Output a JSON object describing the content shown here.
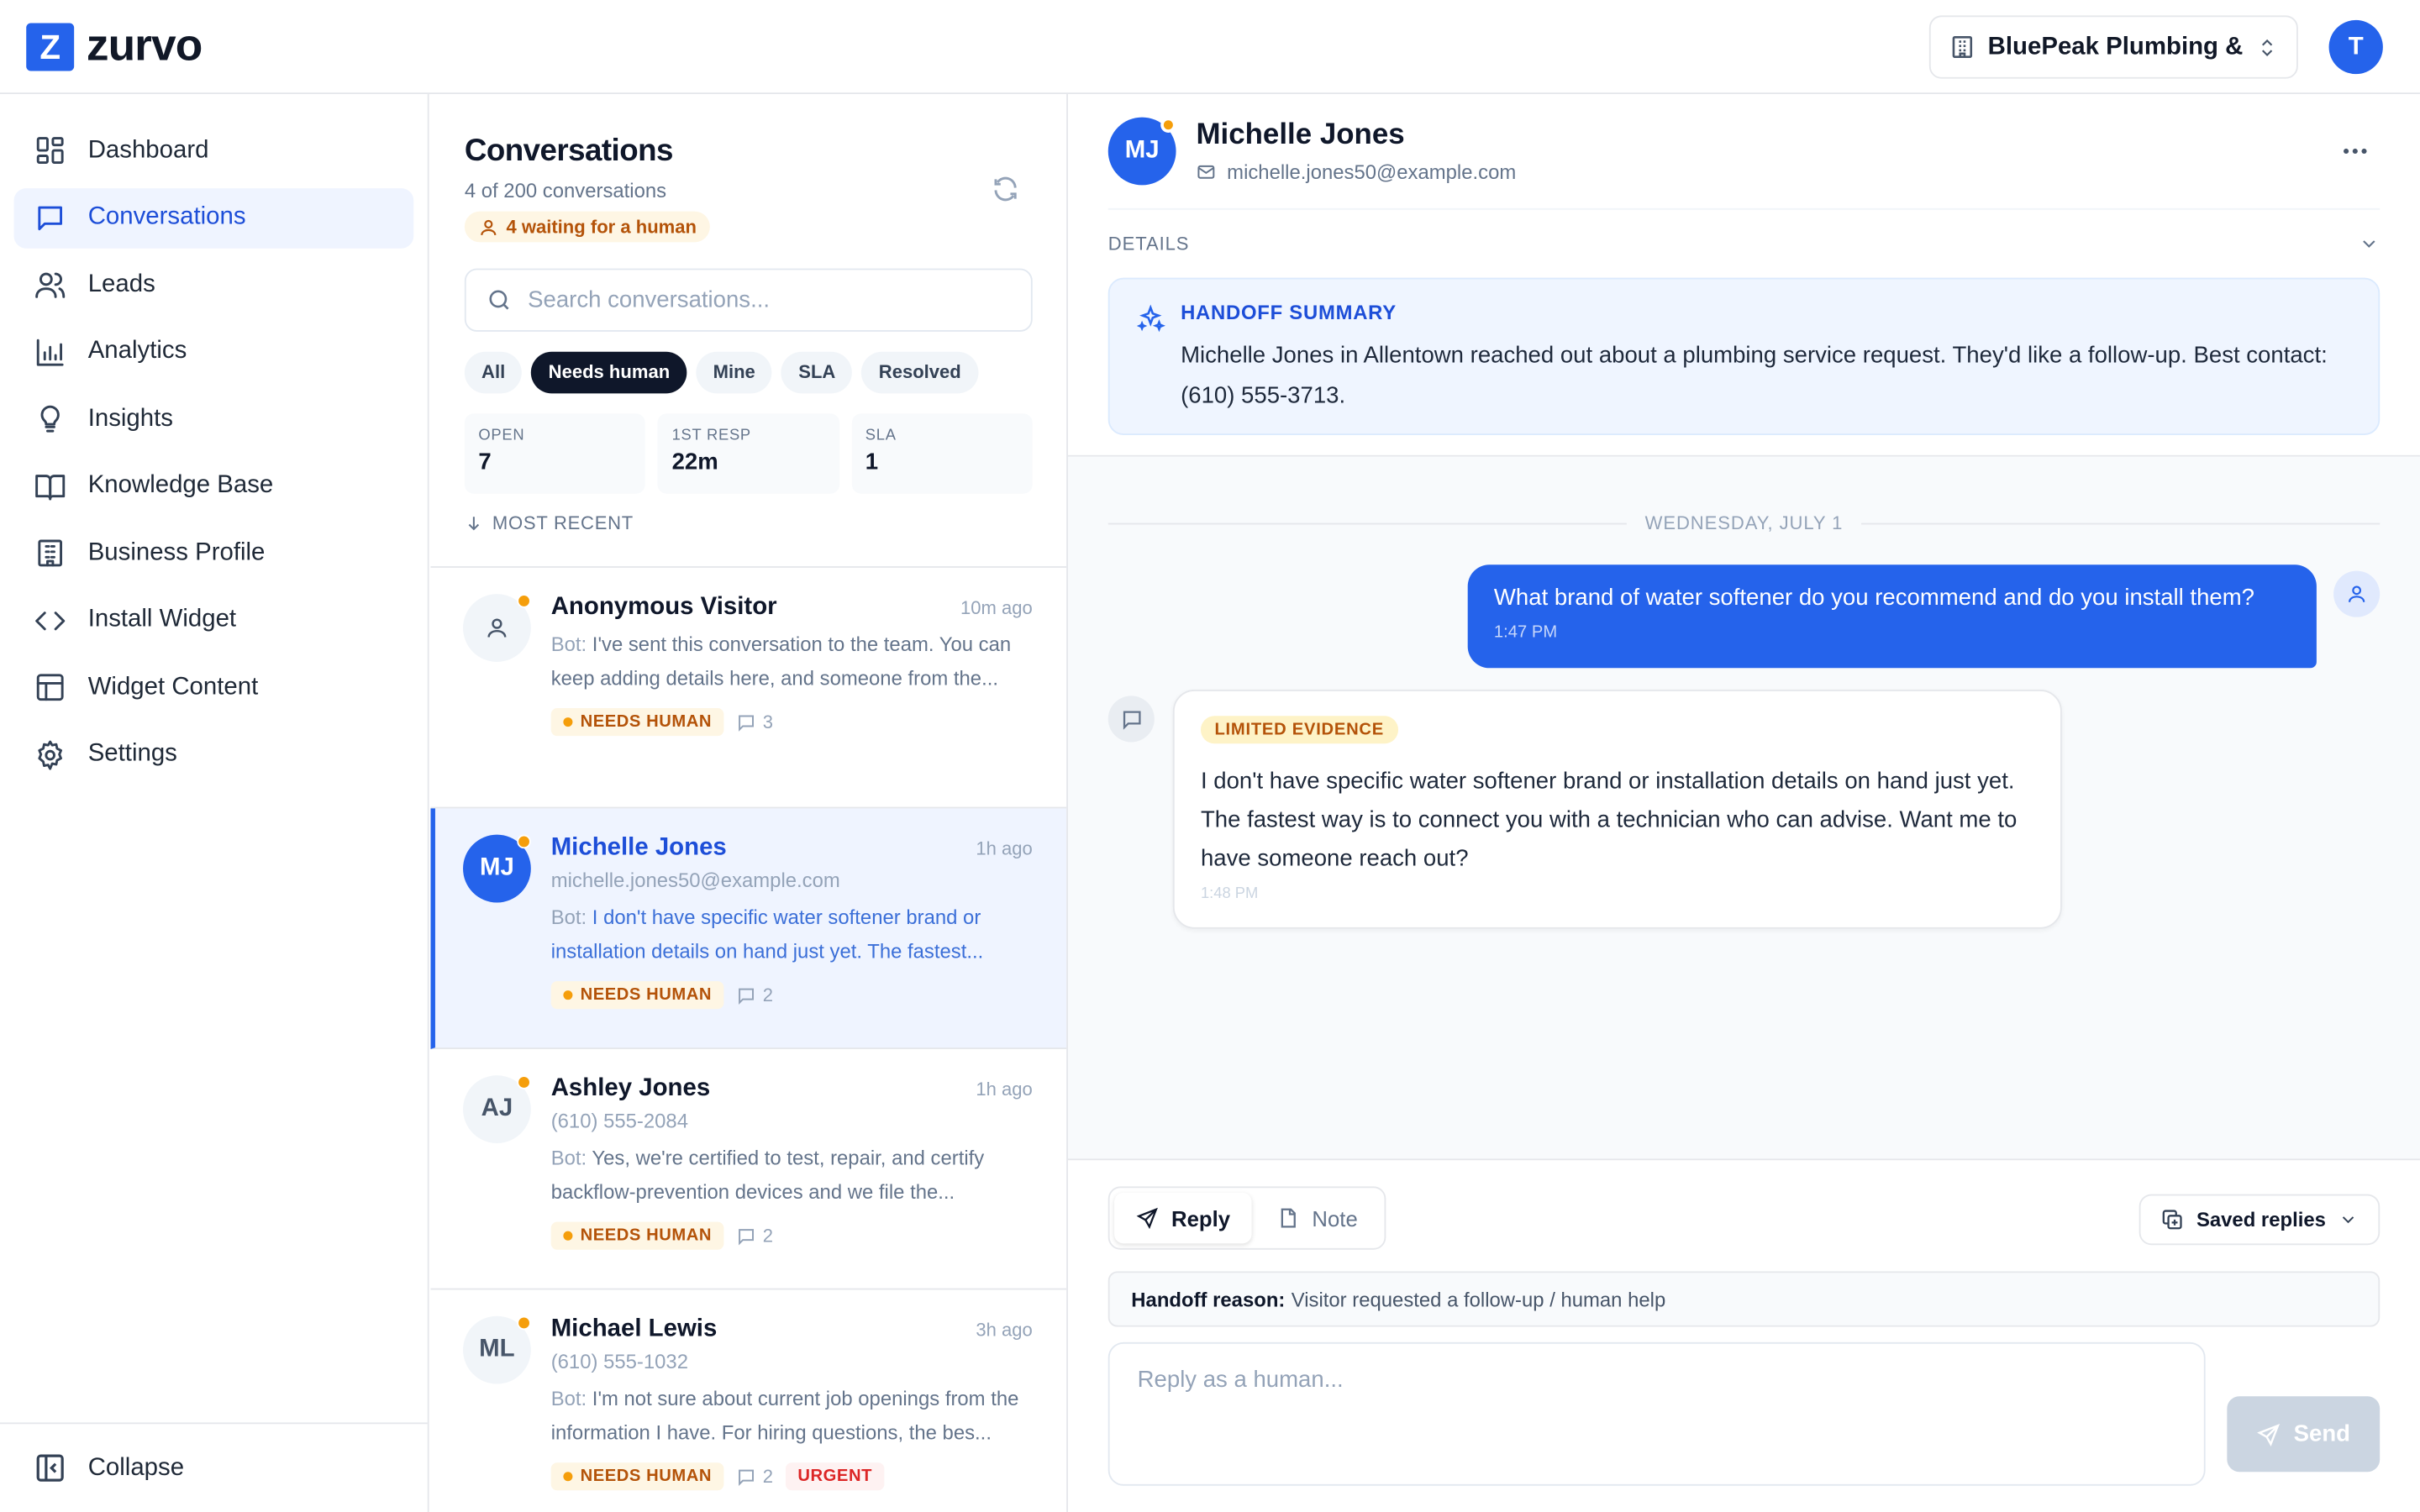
{
  "brand": {
    "logo_letter": "Z",
    "name": "zurvo",
    "accent": "#2563eb"
  },
  "org_switcher": {
    "label": "BluePeak Plumbing & ..."
  },
  "user_avatar": {
    "initial": "T"
  },
  "sidebar": {
    "items": [
      {
        "label": "Dashboard",
        "icon": "dashboard-icon",
        "active": false
      },
      {
        "label": "Conversations",
        "icon": "chat-icon",
        "active": true
      },
      {
        "label": "Leads",
        "icon": "users-icon",
        "active": false
      },
      {
        "label": "Analytics",
        "icon": "bar-chart-icon",
        "active": false
      },
      {
        "label": "Insights",
        "icon": "lightbulb-icon",
        "active": false
      },
      {
        "label": "Knowledge Base",
        "icon": "book-icon",
        "active": false
      },
      {
        "label": "Business Profile",
        "icon": "building-icon",
        "active": false
      },
      {
        "label": "Install Widget",
        "icon": "code-icon",
        "active": false
      },
      {
        "label": "Widget Content",
        "icon": "layout-icon",
        "active": false
      },
      {
        "label": "Settings",
        "icon": "gear-icon",
        "active": false
      }
    ],
    "collapse_label": "Collapse"
  },
  "conversations": {
    "title": "Conversations",
    "count_text": "4 of 200 conversations",
    "waiting_text": "4 waiting for a human",
    "search_placeholder": "Search conversations...",
    "filters": [
      {
        "label": "All",
        "active": false
      },
      {
        "label": "Needs human",
        "active": true
      },
      {
        "label": "Mine",
        "active": false
      },
      {
        "label": "SLA",
        "active": false
      },
      {
        "label": "Resolved",
        "active": false
      }
    ],
    "stats": [
      {
        "label": "OPEN",
        "value": "7"
      },
      {
        "label": "1ST RESP",
        "value": "22m"
      },
      {
        "label": "SLA",
        "value": "1"
      }
    ],
    "sort_label": "MOST RECENT",
    "items": [
      {
        "initials": "",
        "name": "Anonymous Visitor",
        "time": "10m ago",
        "sub": "",
        "bot_prefix": "Bot:",
        "preview": " I've sent this conversation to the team. You can keep adding details here, and someone from the...",
        "tag": "NEEDS HUMAN",
        "messages": "3",
        "urgent": ""
      },
      {
        "initials": "MJ",
        "name": "Michelle Jones",
        "time": "1h ago",
        "sub": "michelle.jones50@example.com",
        "bot_prefix": "Bot:",
        "preview": " I don't have specific water softener brand or installation details on hand just yet. The fastest...",
        "tag": "NEEDS HUMAN",
        "messages": "2",
        "urgent": ""
      },
      {
        "initials": "AJ",
        "name": "Ashley Jones",
        "time": "1h ago",
        "sub": "(610) 555-2084",
        "bot_prefix": "Bot:",
        "preview": " Yes, we're certified to test, repair, and certify backflow-prevention devices and we file the...",
        "tag": "NEEDS HUMAN",
        "messages": "2",
        "urgent": ""
      },
      {
        "initials": "ML",
        "name": "Michael Lewis",
        "time": "3h ago",
        "sub": "(610) 555-1032",
        "bot_prefix": "Bot:",
        "preview": " I'm not sure about current job openings from the information I have. For hiring questions, the bes...",
        "tag": "NEEDS HUMAN",
        "messages": "2",
        "urgent": "URGENT"
      }
    ]
  },
  "contact": {
    "initials": "MJ",
    "name": "Michelle Jones",
    "email": "michelle.jones50@example.com"
  },
  "details_label": "DETAILS",
  "handoff_summary": {
    "title": "HANDOFF SUMMARY",
    "text": "Michelle Jones in Allentown reached out about a plumbing service request. They'd like a follow-up. Best contact: (610) 555-3713."
  },
  "thread": {
    "date": "WEDNESDAY, JULY 1",
    "user_message": {
      "text": "What brand of water softener do you recommend and do you install them?",
      "time": "1:47 PM"
    },
    "bot_message": {
      "badge": "LIMITED EVIDENCE",
      "text": "I don't have specific water softener brand or installation details on hand just yet. The fastest way is to connect you with a technician who can advise. Want me to have someone reach out?",
      "time": "1:48 PM"
    }
  },
  "composer": {
    "reply_tab": "Reply",
    "note_tab": "Note",
    "saved_replies": "Saved replies",
    "handoff_reason_label": "Handoff reason:",
    "handoff_reason": "Visitor requested a follow-up / human help",
    "placeholder": "Reply as a human...",
    "send": "Send"
  }
}
